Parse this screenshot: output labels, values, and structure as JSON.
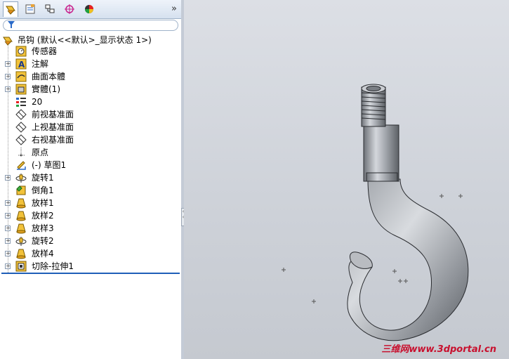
{
  "tabs": [
    {
      "name": "feature-manager",
      "icon": "feature-tree-icon",
      "active": true
    },
    {
      "name": "property-manager",
      "icon": "property-icon"
    },
    {
      "name": "configuration-manager",
      "icon": "configuration-icon"
    },
    {
      "name": "dimxpert",
      "icon": "target-icon"
    },
    {
      "name": "display-manager",
      "icon": "appearance-icon"
    }
  ],
  "expand_label": "»",
  "tree": {
    "root_label": "吊钩 (默认<<默认>_显示状态 1>)",
    "items": [
      {
        "label": "传感器",
        "icon": "sensor-icon",
        "expandable": false
      },
      {
        "label": "注解",
        "icon": "annotation-icon",
        "expandable": true
      },
      {
        "label": "曲面本體",
        "icon": "surface-body-icon",
        "expandable": true
      },
      {
        "label": "實體(1)",
        "icon": "solid-body-icon",
        "expandable": true
      },
      {
        "label": "20",
        "icon": "material-icon",
        "expandable": false
      },
      {
        "label": "前视基准面",
        "icon": "plane-icon",
        "expandable": false
      },
      {
        "label": "上视基准面",
        "icon": "plane-icon",
        "expandable": false
      },
      {
        "label": "右视基准面",
        "icon": "plane-icon",
        "expandable": false
      },
      {
        "label": "原点",
        "icon": "origin-icon",
        "expandable": false
      },
      {
        "label": "(-) 草图1",
        "icon": "sketch-icon",
        "expandable": false
      },
      {
        "label": "旋转1",
        "icon": "revolve-icon",
        "expandable": true
      },
      {
        "label": "倒角1",
        "icon": "chamfer-icon",
        "expandable": false
      },
      {
        "label": "放样1",
        "icon": "loft-icon",
        "expandable": true
      },
      {
        "label": "放样2",
        "icon": "loft-icon",
        "expandable": true
      },
      {
        "label": "放样3",
        "icon": "loft-icon",
        "expandable": true
      },
      {
        "label": "旋转2",
        "icon": "revolve-icon",
        "expandable": true
      },
      {
        "label": "放样4",
        "icon": "loft-icon",
        "expandable": true
      },
      {
        "label": "切除-拉伸1",
        "icon": "cut-extrude-icon",
        "expandable": true
      }
    ]
  },
  "watermark": "三维网www.3dportal.cn"
}
